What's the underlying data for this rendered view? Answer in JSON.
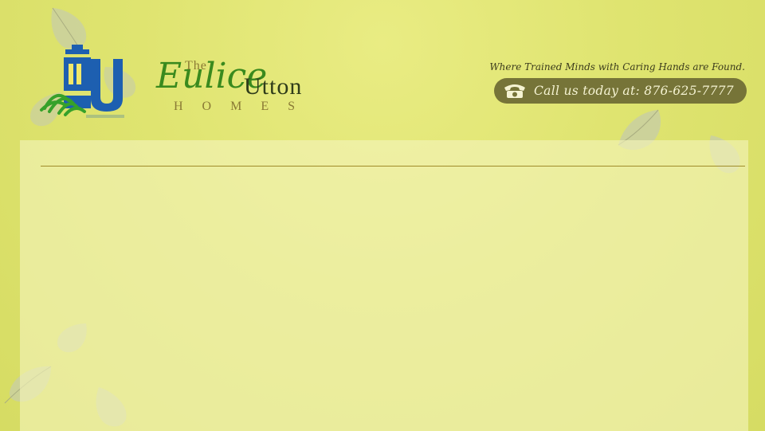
{
  "header": {
    "logo": {
      "monogram": "EU",
      "wordmark": {
        "the": "The",
        "eulice": "Eulice",
        "utton": "Utton",
        "homes": "HOMES"
      }
    },
    "tagline": "Where Trained Minds with Caring Hands are Found.",
    "contact": {
      "icon": "phone-icon",
      "text": "Call us today at: 876-625-7777"
    }
  },
  "colors": {
    "background": "#dfe470",
    "accent_green": "#3a8a1e",
    "logo_blue": "#1d5fb0",
    "pill": "#767438",
    "rule": "#a08c2a"
  }
}
